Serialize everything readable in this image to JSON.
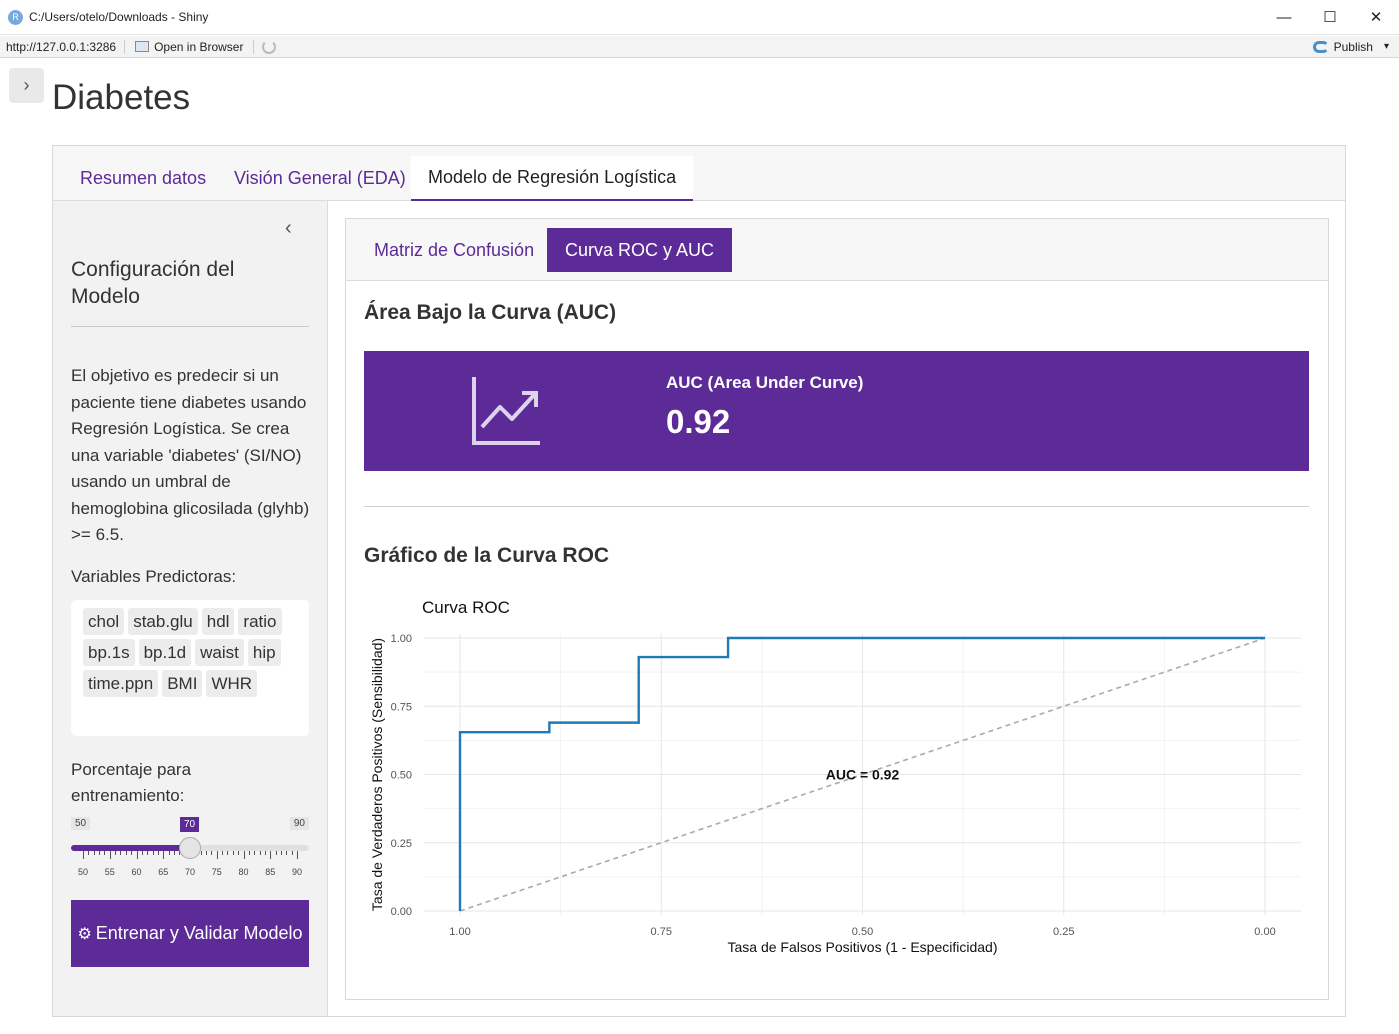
{
  "window": {
    "app_icon": "R",
    "title": "C:/Users/otelo/Downloads - Shiny",
    "minimize": "—",
    "maximize": "☐",
    "close": "✕"
  },
  "toolbar": {
    "url": "http://127.0.0.1:3286",
    "open_browser": "Open in Browser",
    "publish": "Publish",
    "publish_caret": "▾"
  },
  "app": {
    "sidebar_toggle": "›",
    "title": "Diabetes",
    "main_tabs": [
      "Resumen datos",
      "Visión General (EDA)",
      "Modelo de Regresión Logística"
    ]
  },
  "sidebar": {
    "collapse": "‹",
    "title": "Configuración del Modelo",
    "description": "El objetivo es predecir si un paciente tiene diabetes usando Regresión Logística. Se crea una variable 'diabetes' (SI/NO) usando un umbral de hemoglobina glicosilada (glyhb) >= 6.5.",
    "vars_label": "Variables Predictoras:",
    "variables": [
      "chol",
      "stab.glu",
      "hdl",
      "ratio",
      "bp.1s",
      "bp.1d",
      "waist",
      "hip",
      "time.ppn",
      "BMI",
      "WHR"
    ],
    "pct_label": "Porcentaje para entrenamiento:",
    "slider": {
      "min": 50,
      "max": 90,
      "value": 70,
      "min_label": "50",
      "max_label": "90",
      "value_label": "70",
      "tick_labels": [
        "50",
        "55",
        "60",
        "65",
        "70",
        "75",
        "80",
        "85",
        "90"
      ]
    },
    "train_button_icon": "⚙",
    "train_button": "Entrenar y Validar Modelo"
  },
  "content": {
    "sub_tabs": [
      "Matriz de Confusión",
      "Curva ROC y AUC"
    ],
    "auc_heading": "Área Bajo la Curva (AUC)",
    "value_box": {
      "label": "AUC (Area Under Curve)",
      "value": "0.92",
      "icon": "chart-line-icon"
    },
    "roc_heading": "Gráfico de la Curva ROC"
  },
  "colors": {
    "accent": "#5c2b97",
    "roc_line": "#1f7ab5",
    "diagonal": "#aaaaaa"
  },
  "chart_data": {
    "type": "line",
    "title": "Curva ROC",
    "xlabel": "Tasa de Falsos Positivos (1 - Especificidad)",
    "ylabel": "Tasa de Verdaderos Positivos (Sensibilidad)",
    "xlim": [
      1.0,
      0.0
    ],
    "ylim": [
      0.0,
      1.0
    ],
    "x_reversed": true,
    "x_ticks": [
      "1.00",
      "0.75",
      "0.50",
      "0.25",
      "0.00"
    ],
    "y_ticks": [
      "0.00",
      "0.25",
      "0.50",
      "0.75",
      "1.00"
    ],
    "grid": true,
    "annotation": "AUC = 0.92",
    "series": [
      {
        "x": [
          1.0,
          1.0,
          0.889,
          0.889,
          0.778,
          0.778,
          0.667,
          0.667,
          0.0
        ],
        "y": [
          0.0,
          0.655,
          0.655,
          0.69,
          0.69,
          0.93,
          0.93,
          1.0,
          1.0
        ]
      },
      {
        "x": [
          1.0,
          0.0
        ],
        "y": [
          0.0,
          1.0
        ]
      }
    ]
  }
}
